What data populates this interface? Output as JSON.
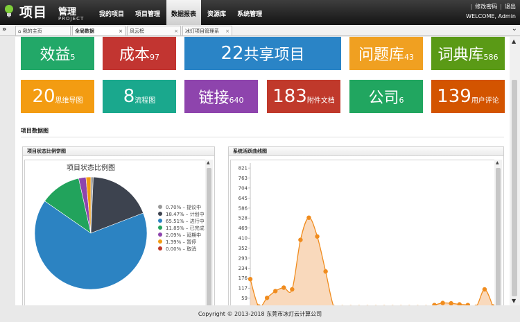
{
  "app": {
    "title_main": "项目",
    "title_sub": "管理",
    "title_en": "PROJECT"
  },
  "nav": [
    "我的项目",
    "项目管理",
    "数据报表",
    "资源库",
    "系统管理"
  ],
  "user": {
    "change_password": "修改密码",
    "logout": "退出",
    "welcome": "WELCOME, Admin"
  },
  "tabs": [
    {
      "label": "我的主页",
      "icon": "home-icon"
    },
    {
      "label": "全局数据"
    },
    {
      "label": "风云榜"
    },
    {
      "label": "冰灯项目管理系"
    }
  ],
  "stats": [
    {
      "num": "",
      "label": "效益",
      "suffix": "5",
      "color": "#22a868"
    },
    {
      "num": "",
      "label": "成本",
      "suffix": "97",
      "color": "#c23531"
    },
    {
      "num": "22",
      "label": "共享项目",
      "suffix": "",
      "color": "#2a84c6"
    },
    {
      "num": "",
      "label": "问题库",
      "suffix": "43",
      "color": "#f0a021"
    },
    {
      "num": "",
      "label": "词典库",
      "suffix": "586",
      "color": "#5a9a16"
    },
    {
      "num": "20",
      "label": "",
      "suffix": "思维导图",
      "color": "#f39c12"
    },
    {
      "num": "8",
      "label": "",
      "suffix": "流程图",
      "color": "#1aa88d"
    },
    {
      "num": "",
      "label": "链接",
      "suffix": "640",
      "color": "#8e44ad"
    },
    {
      "num": "183",
      "label": "",
      "suffix": "附件文档",
      "color": "#c0392b"
    },
    {
      "num": "",
      "label": "公司",
      "suffix": "6",
      "color": "#21a660"
    },
    {
      "num": "139",
      "label": "",
      "suffix": "用户评论",
      "color": "#d35400"
    }
  ],
  "section_title": "项目数据图",
  "pie_panel_title": "项目状态比例饼图",
  "line_panel_title": "系统活跃曲线图",
  "footer": "Copyright © 2013-2018 东莞市冰灯云计算公司",
  "chart_data": [
    {
      "type": "pie",
      "title": "项目状态比例图",
      "legend": [
        "0.70% – 提议中",
        "18.47% – 计划中",
        "65.51% – 进行中",
        "11.85% – 已完成",
        "2.09% – 延期中",
        "1.39% – 暂停",
        "0.00% – 取消"
      ],
      "slices": [
        {
          "name": "提议中",
          "value": 0.7,
          "color": "#9a9a9a"
        },
        {
          "name": "计划中",
          "value": 18.47,
          "color": "#3d434f"
        },
        {
          "name": "进行中",
          "value": 65.51,
          "color": "#2c83c2"
        },
        {
          "name": "已完成",
          "value": 11.85,
          "color": "#22a35c"
        },
        {
          "name": "延期中",
          "value": 2.09,
          "color": "#8e44ad"
        },
        {
          "name": "暂停",
          "value": 1.39,
          "color": "#f39c12"
        },
        {
          "name": "取消",
          "value": 0.0,
          "color": "#c0392b"
        }
      ],
      "legend_placement": "right"
    },
    {
      "type": "area",
      "ylim": [
        0,
        850
      ],
      "yticks": [
        0,
        59,
        117,
        176,
        234,
        293,
        352,
        410,
        469,
        528,
        586,
        645,
        704,
        763,
        821
      ],
      "y": [
        170,
        10,
        60,
        100,
        120,
        110,
        400,
        530,
        420,
        215,
        5,
        5,
        5,
        5,
        5,
        5,
        5,
        5,
        5,
        5,
        5,
        5,
        18,
        30,
        28,
        22,
        18,
        8,
        110,
        10
      ],
      "color": "#f08c1e",
      "fill": "#f8d2b0",
      "grid": false
    }
  ]
}
